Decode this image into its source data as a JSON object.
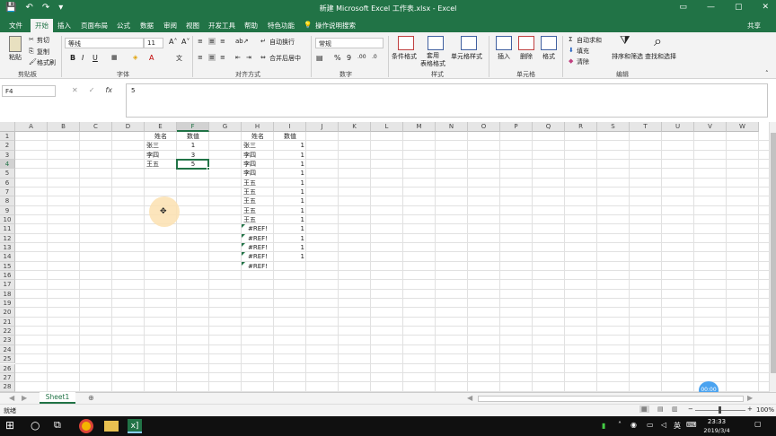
{
  "titlebar": {
    "title": "新建 Microsoft Excel 工作表.xlsx - Excel",
    "qat": [
      "💾",
      "↶",
      "↷",
      "▾"
    ],
    "buttons": [
      "▭",
      "—",
      "▢",
      "✕"
    ]
  },
  "tabs": [
    "文件",
    "开始",
    "插入",
    "页面布局",
    "公式",
    "数据",
    "审阅",
    "视图",
    "开发工具",
    "帮助",
    "特色功能",
    "操作说明搜索"
  ],
  "share_label": "共享",
  "ribbon": {
    "clipboard": {
      "paste": "粘贴",
      "cut": "剪切",
      "copy": "复制",
      "format_painter": "格式刷",
      "group": "剪贴板"
    },
    "font": {
      "name": "等线",
      "size": "11",
      "bold": "B",
      "italic": "I",
      "underline": "U",
      "group": "字体"
    },
    "align": {
      "wrap": "自动换行",
      "merge": "合并后居中",
      "group": "对齐方式"
    },
    "number": {
      "format": "常规",
      "group": "数字"
    },
    "styles": {
      "cond": "条件格式",
      "table": "套用\n表格格式",
      "cell": "单元格样式",
      "group": "样式"
    },
    "cells": {
      "insert": "插入",
      "delete": "删除",
      "format": "格式",
      "group": "单元格"
    },
    "editing": {
      "autosum": "自动求和",
      "fill": "填充",
      "clear": "清除",
      "sort": "排序和筛选",
      "find": "查找和选择",
      "group": "编辑"
    }
  },
  "formula_bar": {
    "name_box": "F4",
    "content": "5"
  },
  "columns": [
    "A",
    "B",
    "C",
    "D",
    "E",
    "F",
    "G",
    "H",
    "I",
    "J",
    "K",
    "L",
    "M",
    "N",
    "O",
    "P",
    "Q",
    "R",
    "S",
    "T",
    "U",
    "V",
    "W"
  ],
  "rows": [
    "1",
    "2",
    "3",
    "4",
    "5",
    "6",
    "7",
    "8",
    "9",
    "10",
    "11",
    "12",
    "13",
    "14",
    "15",
    "16",
    "17",
    "18",
    "19",
    "20",
    "21",
    "22",
    "23",
    "24",
    "25",
    "26",
    "27",
    "28"
  ],
  "cells": {
    "E1": "姓名",
    "F1": "数值",
    "E2": "张三",
    "F2": "1",
    "E3": "李四",
    "F3": "3",
    "E4": "王五",
    "F4": "5",
    "H1": "姓名",
    "I1": "数值",
    "H2": "张三",
    "I2": "1",
    "H3": "李四",
    "I3": "1",
    "H4": "李四",
    "I4": "1",
    "H5": "李四",
    "I5": "1",
    "H6": "王五",
    "I6": "1",
    "H7": "王五",
    "I7": "1",
    "H8": "王五",
    "I8": "1",
    "H9": "王五",
    "I9": "1",
    "H10": "王五",
    "I10": "1",
    "H11": "#REF!",
    "I11": "1",
    "H12": "#REF!",
    "I12": "1",
    "H13": "#REF!",
    "I13": "1",
    "H14": "#REF!",
    "I14": "1",
    "H15": "#REF!"
  },
  "sheet_tab": "Sheet1",
  "status": {
    "ready": "就绪",
    "zoom": "100%",
    "rec_time": "00:00"
  },
  "taskbar": {
    "time": "23:33",
    "date": "2019/3/4",
    "ime": "英"
  },
  "colors": {
    "accent": "#217346",
    "selection": "#217346"
  }
}
